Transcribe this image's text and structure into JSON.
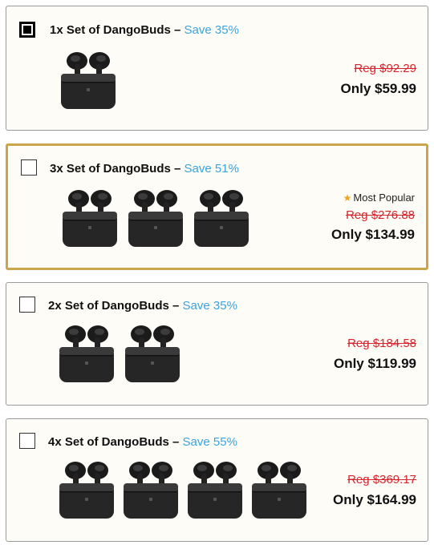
{
  "offers": [
    {
      "title": "1x Set of DangoBuds",
      "dash": "–",
      "save": "Save 35%",
      "reg": "Reg $92.29",
      "only": "Only $59.99",
      "checked": true,
      "count": 1
    },
    {
      "title": "3x Set of DangoBuds",
      "dash": "–",
      "save": "Save 51%",
      "badge": "Most Popular",
      "reg": "Reg $276.88",
      "only": "Only $134.99",
      "checked": false,
      "count": 3
    },
    {
      "title": "2x Set of DangoBuds",
      "dash": "–",
      "save": "Save 35%",
      "reg": "Reg $184.58",
      "only": "Only $119.99",
      "checked": false,
      "count": 2
    },
    {
      "title": "4x Set of DangoBuds",
      "dash": "–",
      "save": "Save 55%",
      "reg": "Reg $369.17",
      "only": "Only $164.99",
      "checked": false,
      "count": 4
    }
  ],
  "colors": {
    "save": "#3aa3dd",
    "reg": "#d9232d",
    "featured_border": "#c9a64a",
    "star": "#f2a21b"
  },
  "icons": {
    "badge": "star-icon",
    "product": "earbuds-case-image"
  }
}
